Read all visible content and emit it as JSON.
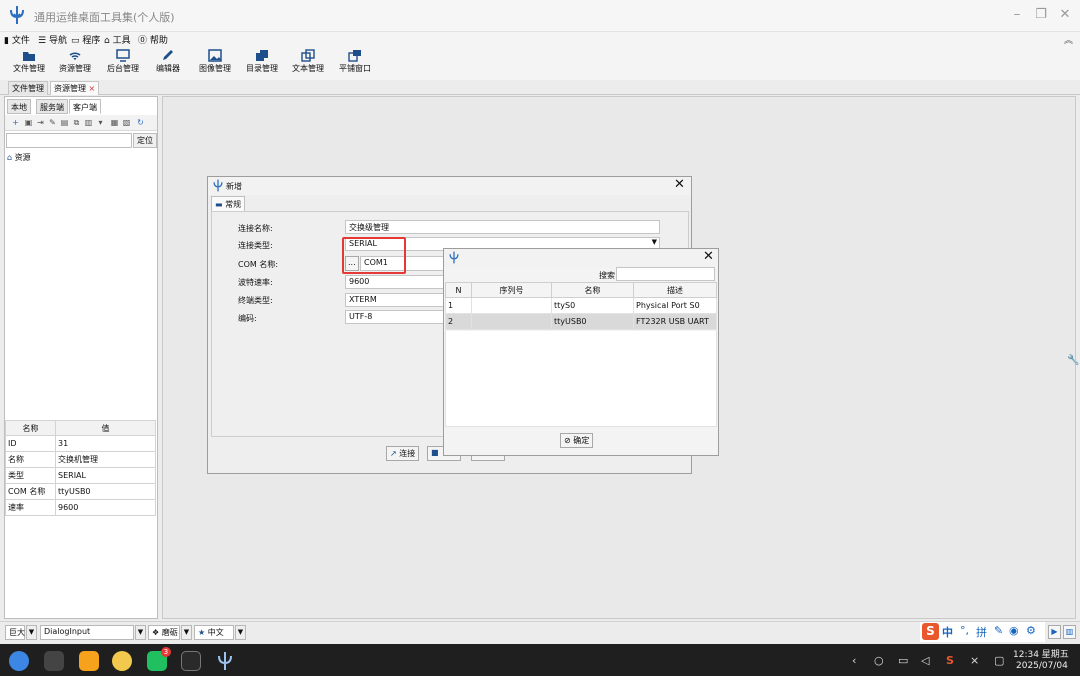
{
  "window": {
    "title": "通用运维桌面工具集(个人版)"
  },
  "menubar": {
    "file": "文件",
    "nav": "导航",
    "program": "程序",
    "tools": "工具",
    "help": "帮助"
  },
  "toolbar": {
    "items": [
      "文件管理",
      "资源管理",
      "后台管理",
      "编辑器",
      "图像管理",
      "目录管理",
      "文本管理",
      "平铺窗口"
    ]
  },
  "doc_tabs": [
    "文件管理",
    "资源管理"
  ],
  "left": {
    "tabs": [
      "本地",
      "服务端",
      "客户端"
    ],
    "locate": "定位",
    "tree_root": "资源",
    "props": {
      "headers": [
        "名称",
        "值"
      ],
      "rows": [
        [
          "ID",
          "31"
        ],
        [
          "名称",
          "交换机管理"
        ],
        [
          "类型",
          "SERIAL"
        ],
        [
          "COM 名称",
          "ttyUSB0"
        ],
        [
          "速率",
          "9600"
        ]
      ]
    }
  },
  "dialog_new": {
    "title": "新增",
    "tab": "常规",
    "fields": {
      "name_label": "连接名称:",
      "name_value": "交换级管理",
      "type_label": "连接类型:",
      "type_value": "SERIAL",
      "com_label": "COM 名称:",
      "com_btn": "...",
      "com_value": "COM1",
      "baud_label": "波特速率:",
      "baud_value": "9600",
      "term_label": "终端类型:",
      "term_value": "XTERM",
      "enc_label": "编码:",
      "enc_value": "UTF-8"
    },
    "connect": "连接"
  },
  "dialog_select": {
    "search_label": "搜索",
    "headers": [
      "N",
      "序列号",
      "名称",
      "描述"
    ],
    "rows": [
      [
        "1",
        "",
        "ttyS0",
        "Physical Port S0"
      ],
      [
        "2",
        "",
        "ttyUSB0",
        "FT232R USB UART"
      ]
    ],
    "ok": "确定"
  },
  "statusbar": {
    "size": "巨大",
    "style": "DialogInput",
    "theme": "磨砺",
    "lang": "中文"
  },
  "taskbar": {
    "time": "12:34 星期五",
    "date": "2025/07/04",
    "badge": "3"
  },
  "colors": {
    "highlight": "#e53935",
    "accent": "#1565c0"
  }
}
